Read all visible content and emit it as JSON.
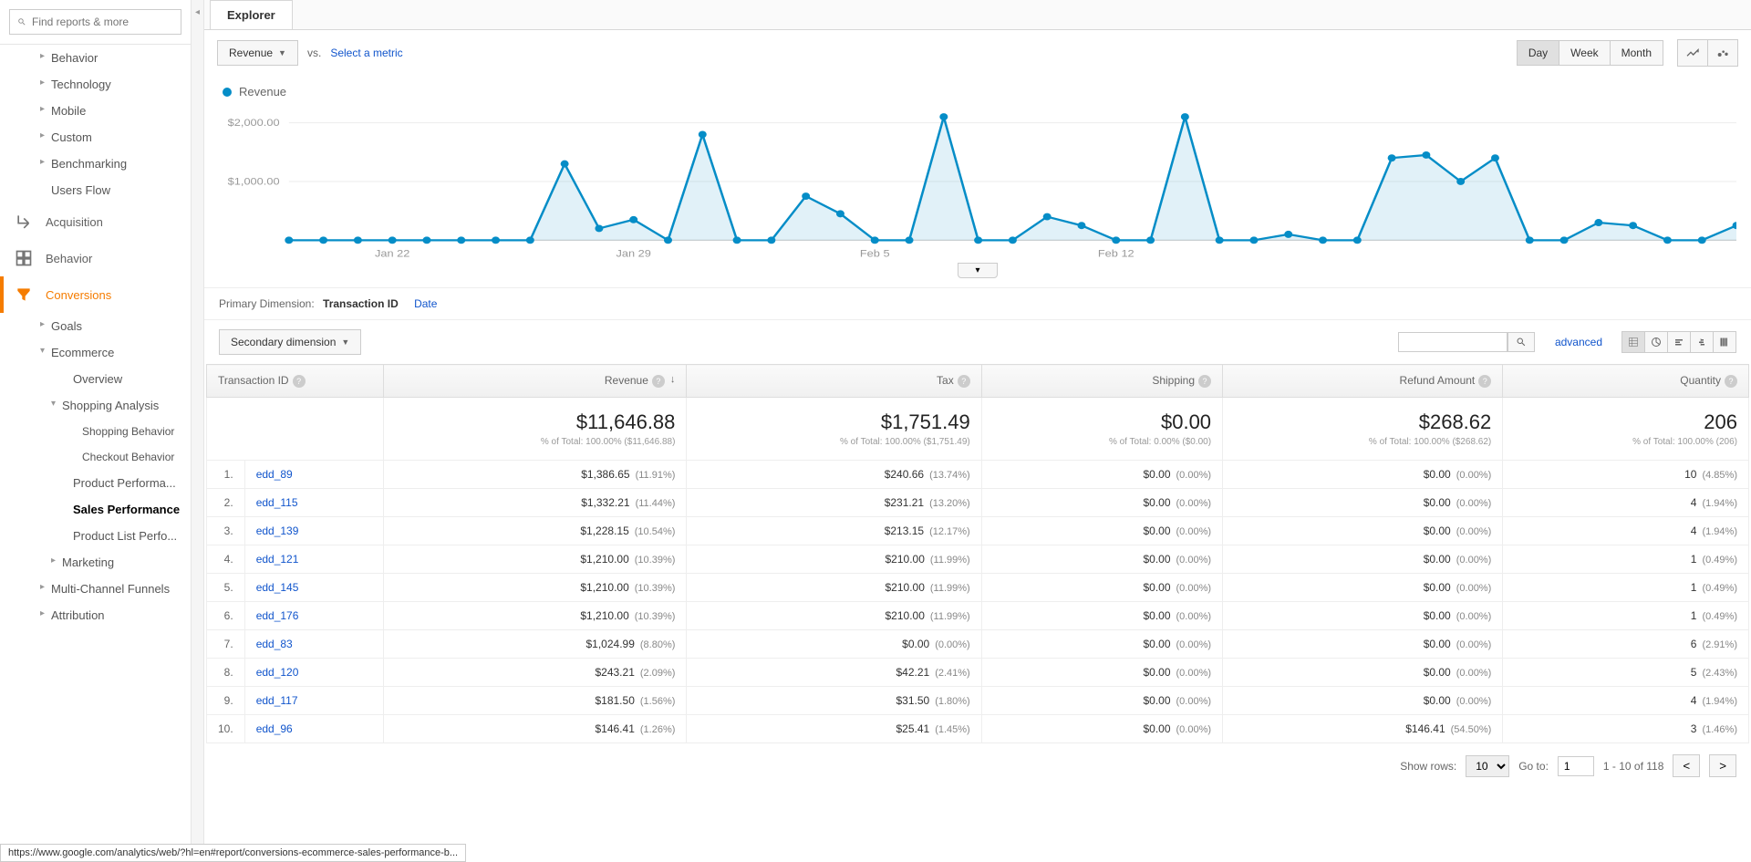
{
  "search_placeholder": "Find reports & more",
  "sidebar": {
    "items1": [
      "Behavior",
      "Technology",
      "Mobile",
      "Custom",
      "Benchmarking"
    ],
    "users_flow": "Users Flow",
    "acquisition": "Acquisition",
    "behavior": "Behavior",
    "conversions": "Conversions",
    "conv_items": {
      "goals": "Goals",
      "ecommerce": "Ecommerce",
      "overview": "Overview",
      "shopping_analysis": "Shopping Analysis",
      "shopping_behavior": "Shopping Behavior",
      "checkout_behavior": "Checkout Behavior",
      "product_perf": "Product Performa...",
      "sales_perf": "Sales Performance",
      "product_list": "Product List Perfo...",
      "marketing": "Marketing",
      "mcf": "Multi-Channel Funnels",
      "attribution": "Attribution"
    }
  },
  "tab": "Explorer",
  "metric_btn": "Revenue",
  "vs": "vs.",
  "select_metric": "Select a metric",
  "time": {
    "day": "Day",
    "week": "Week",
    "month": "Month"
  },
  "legend": "Revenue",
  "primary_dim_label": "Primary Dimension:",
  "primary_dim": "Transaction ID",
  "date_link": "Date",
  "secondary_dim": "Secondary dimension",
  "advanced": "advanced",
  "columns": [
    "Transaction ID",
    "Revenue",
    "Tax",
    "Shipping",
    "Refund Amount",
    "Quantity"
  ],
  "summary": {
    "revenue": {
      "val": "$11,646.88",
      "sub": "% of Total: 100.00% ($11,646.88)"
    },
    "tax": {
      "val": "$1,751.49",
      "sub": "% of Total: 100.00% ($1,751.49)"
    },
    "shipping": {
      "val": "$0.00",
      "sub": "% of Total: 0.00% ($0.00)"
    },
    "refund": {
      "val": "$268.62",
      "sub": "% of Total: 100.00% ($268.62)"
    },
    "quantity": {
      "val": "206",
      "sub": "% of Total: 100.00% (206)"
    }
  },
  "rows": [
    {
      "n": "1.",
      "id": "edd_89",
      "rev": "$1,386.65",
      "revp": "(11.91%)",
      "tax": "$240.66",
      "taxp": "(13.74%)",
      "ship": "$0.00",
      "shipp": "(0.00%)",
      "ref": "$0.00",
      "refp": "(0.00%)",
      "qty": "10",
      "qtyp": "(4.85%)"
    },
    {
      "n": "2.",
      "id": "edd_115",
      "rev": "$1,332.21",
      "revp": "(11.44%)",
      "tax": "$231.21",
      "taxp": "(13.20%)",
      "ship": "$0.00",
      "shipp": "(0.00%)",
      "ref": "$0.00",
      "refp": "(0.00%)",
      "qty": "4",
      "qtyp": "(1.94%)"
    },
    {
      "n": "3.",
      "id": "edd_139",
      "rev": "$1,228.15",
      "revp": "(10.54%)",
      "tax": "$213.15",
      "taxp": "(12.17%)",
      "ship": "$0.00",
      "shipp": "(0.00%)",
      "ref": "$0.00",
      "refp": "(0.00%)",
      "qty": "4",
      "qtyp": "(1.94%)"
    },
    {
      "n": "4.",
      "id": "edd_121",
      "rev": "$1,210.00",
      "revp": "(10.39%)",
      "tax": "$210.00",
      "taxp": "(11.99%)",
      "ship": "$0.00",
      "shipp": "(0.00%)",
      "ref": "$0.00",
      "refp": "(0.00%)",
      "qty": "1",
      "qtyp": "(0.49%)"
    },
    {
      "n": "5.",
      "id": "edd_145",
      "rev": "$1,210.00",
      "revp": "(10.39%)",
      "tax": "$210.00",
      "taxp": "(11.99%)",
      "ship": "$0.00",
      "shipp": "(0.00%)",
      "ref": "$0.00",
      "refp": "(0.00%)",
      "qty": "1",
      "qtyp": "(0.49%)"
    },
    {
      "n": "6.",
      "id": "edd_176",
      "rev": "$1,210.00",
      "revp": "(10.39%)",
      "tax": "$210.00",
      "taxp": "(11.99%)",
      "ship": "$0.00",
      "shipp": "(0.00%)",
      "ref": "$0.00",
      "refp": "(0.00%)",
      "qty": "1",
      "qtyp": "(0.49%)"
    },
    {
      "n": "7.",
      "id": "edd_83",
      "rev": "$1,024.99",
      "revp": "(8.80%)",
      "tax": "$0.00",
      "taxp": "(0.00%)",
      "ship": "$0.00",
      "shipp": "(0.00%)",
      "ref": "$0.00",
      "refp": "(0.00%)",
      "qty": "6",
      "qtyp": "(2.91%)"
    },
    {
      "n": "8.",
      "id": "edd_120",
      "rev": "$243.21",
      "revp": "(2.09%)",
      "tax": "$42.21",
      "taxp": "(2.41%)",
      "ship": "$0.00",
      "shipp": "(0.00%)",
      "ref": "$0.00",
      "refp": "(0.00%)",
      "qty": "5",
      "qtyp": "(2.43%)"
    },
    {
      "n": "9.",
      "id": "edd_117",
      "rev": "$181.50",
      "revp": "(1.56%)",
      "tax": "$31.50",
      "taxp": "(1.80%)",
      "ship": "$0.00",
      "shipp": "(0.00%)",
      "ref": "$0.00",
      "refp": "(0.00%)",
      "qty": "4",
      "qtyp": "(1.94%)"
    },
    {
      "n": "10.",
      "id": "edd_96",
      "rev": "$146.41",
      "revp": "(1.26%)",
      "tax": "$25.41",
      "taxp": "(1.45%)",
      "ship": "$0.00",
      "shipp": "(0.00%)",
      "ref": "$146.41",
      "refp": "(54.50%)",
      "qty": "3",
      "qtyp": "(1.46%)"
    }
  ],
  "pagination": {
    "show_rows": "Show rows:",
    "rows_val": "10",
    "goto": "Go to:",
    "goto_val": "1",
    "range": "1 - 10 of 118"
  },
  "status_url": "https://www.google.com/analytics/web/?hl=en#report/conversions-ecommerce-sales-performance-b...",
  "chart_data": {
    "type": "line",
    "ylabel": "Revenue",
    "ylim": [
      0,
      2000
    ],
    "yticks": [
      "$1,000.00",
      "$2,000.00"
    ],
    "xticks": [
      "Jan 22",
      "Jan 29",
      "Feb 5",
      "Feb 12"
    ],
    "series": [
      {
        "name": "Revenue",
        "values": [
          0,
          0,
          0,
          0,
          0,
          0,
          0,
          0,
          1300,
          200,
          350,
          0,
          1800,
          0,
          0,
          750,
          450,
          0,
          0,
          2100,
          0,
          0,
          400,
          250,
          0,
          0,
          2100,
          0,
          0,
          100,
          0,
          0,
          1400,
          1450,
          1000,
          1400,
          0,
          0,
          300,
          250,
          0,
          0,
          250
        ]
      }
    ]
  }
}
